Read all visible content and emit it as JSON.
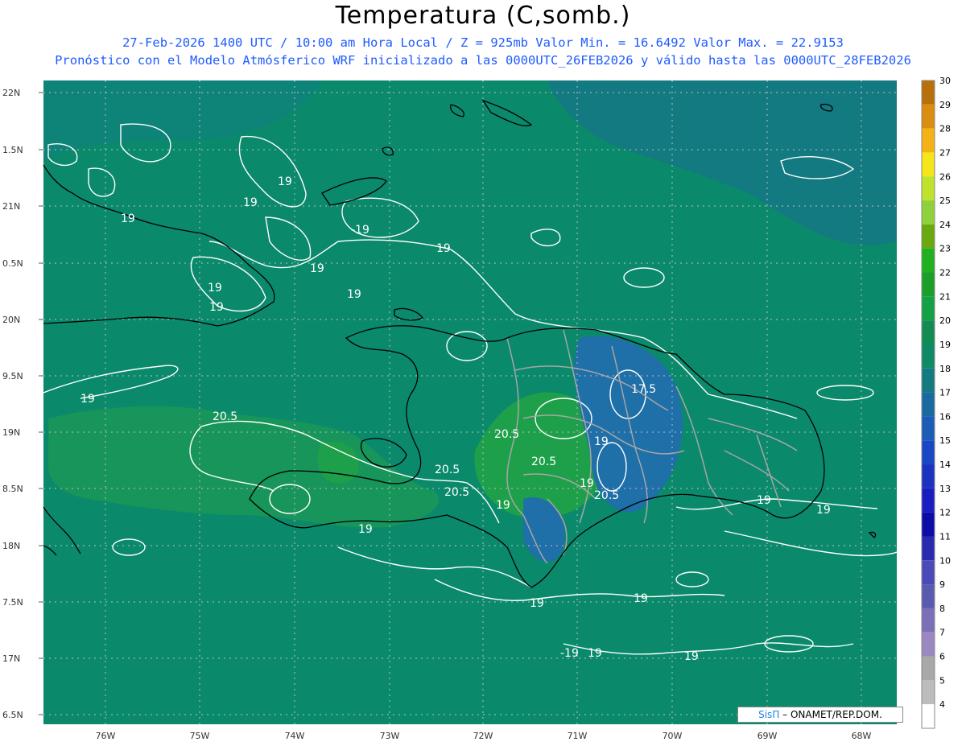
{
  "header": {
    "title": "Temperatura (C,somb.)",
    "line1": "27-Feb-2026  1400 UTC / 10:00 am Hora Local / Z = 925mb   Valor Min. = 16.6492  Valor Max. = 22.9153",
    "line2": "Pronóstico con el Modelo Atmósferico WRF inicializado a las 0000UTC_26FEB2026 y válido hasta las  0000UTC_28FEB2026"
  },
  "map": {
    "lat_ticks": [
      "22N",
      "1.5N",
      "21N",
      "0.5N",
      "20N",
      "9.5N",
      "19N",
      "8.5N",
      "18N",
      "7.5N",
      "17N",
      "6.5N"
    ],
    "lon_ticks": [
      "76W",
      "75W",
      "74W",
      "73W",
      "72W",
      "71W",
      "70W",
      "69W",
      "68W"
    ],
    "contour_labels": [
      {
        "text": "19"
      },
      {
        "text": "19"
      },
      {
        "text": "19"
      },
      {
        "text": "-19"
      },
      {
        "text": "19"
      },
      {
        "text": "19"
      },
      {
        "text": "19"
      },
      {
        "text": "19"
      },
      {
        "text": "19"
      },
      {
        "text": "19"
      },
      {
        "text": "20.5"
      },
      {
        "text": "20.5"
      },
      {
        "text": "20.5"
      },
      {
        "text": "20.5"
      },
      {
        "text": "20.5"
      },
      {
        "text": "17.5"
      },
      {
        "text": "19"
      },
      {
        "text": "19"
      },
      {
        "text": "20.5"
      },
      {
        "text": "19"
      },
      {
        "text": "19"
      },
      {
        "text": "19"
      },
      {
        "text": "19"
      },
      {
        "text": "19"
      },
      {
        "text": "-19"
      },
      {
        "text": "19"
      },
      {
        "text": "19"
      },
      {
        "text": "19"
      }
    ],
    "colors": {
      "ocean": "#0a8a6a",
      "cool": "#1f7ea0",
      "warm": "#1ea04a",
      "contour": "#ffffff",
      "coast": "#000000",
      "provinces": "#a0a0a0"
    }
  },
  "colorbar": {
    "levels": [
      "30",
      "29",
      "28",
      "27",
      "26",
      "25",
      "24",
      "23",
      "22",
      "21",
      "20",
      "19",
      "18",
      "17",
      "16",
      "15",
      "14",
      "13",
      "12",
      "11",
      "10",
      "9",
      "8",
      "7",
      "6",
      "5",
      "4"
    ],
    "colors": [
      "#b8700a",
      "#d98e10",
      "#f5b214",
      "#f5e619",
      "#bfe32a",
      "#8fd13a",
      "#6aa80f",
      "#20b020",
      "#1aa02a",
      "#14a045",
      "#128c52",
      "#0e8a66",
      "#127a80",
      "#1a6aa0",
      "#1a5cb8",
      "#1a48c4",
      "#1a34c0",
      "#1a1ec0",
      "#0c0ca8",
      "#2a2ab0",
      "#4a4ab8",
      "#5a5ab0",
      "#7a70b8",
      "#9a88c0",
      "#a8a8a8",
      "#bcbcbc",
      "#dadada"
    ]
  },
  "credit": {
    "sis": "SisΠ",
    "org": "– ONAMET/REP.DOM."
  }
}
